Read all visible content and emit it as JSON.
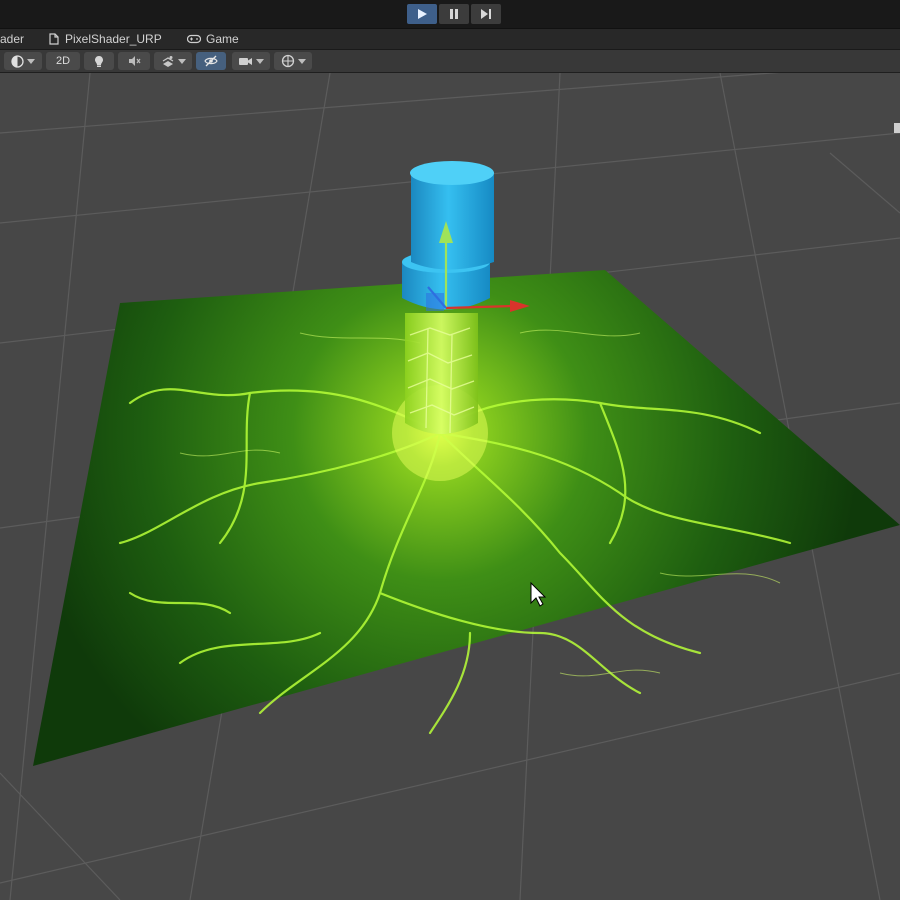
{
  "toolbar_play": {
    "play": "play-icon",
    "pause": "pause-icon",
    "step": "step-icon",
    "accent": "#3e5f8a"
  },
  "tabs": [
    {
      "label": "ader",
      "icon": "shader-icon"
    },
    {
      "label": "PixelShader_URP",
      "icon": "scene-icon"
    },
    {
      "label": "Game",
      "icon": "gamepad-icon"
    }
  ],
  "scene_toolbar": {
    "shading_mode_icon": "sphere-icon",
    "mode_2d_label": "2D",
    "lighting_icon": "light-bulb-icon",
    "audio_icon": "audio-icon",
    "effects_icon": "effects-icon",
    "visibility_icon": "hidden-eye-icon",
    "camera_icon": "camera-icon",
    "gizmos_icon": "gizmos-icon"
  },
  "scene": {
    "ground_plane_color": "#2f7a1a",
    "glow_color": "#b8ff30",
    "cylinder_color": "#26a8de",
    "gizmo_y_color": "#9fe35a",
    "gizmo_x_color": "#d9342b",
    "gizmo_z_color": "#2e6fe0",
    "grid_color": "#5a5a5a"
  }
}
